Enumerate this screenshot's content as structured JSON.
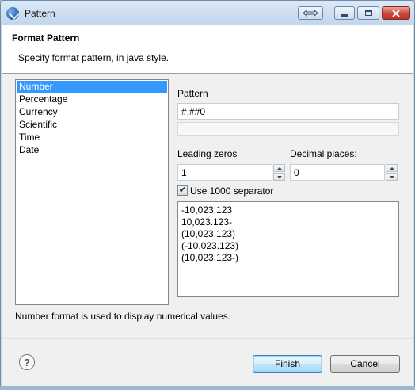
{
  "window": {
    "title": "Pattern",
    "icon": "app-icon",
    "controls": [
      "resize-icon",
      "minimize-icon",
      "maximize-icon",
      "close-icon"
    ]
  },
  "header": {
    "title": "Format Pattern",
    "description": "Specify format pattern, in java style."
  },
  "categories": {
    "items": [
      "Number",
      "Percentage",
      "Currency",
      "Scientific",
      "Time",
      "Date"
    ],
    "selected": "Number"
  },
  "pattern": {
    "label": "Pattern",
    "value": "#,##0",
    "secondary_value": ""
  },
  "leading_zeros": {
    "label": "Leading zeros",
    "value": "1"
  },
  "decimal_places": {
    "label": "Decimal places:",
    "value": "0"
  },
  "use_separator": {
    "label": "Use 1000 separator",
    "checked": true
  },
  "samples": [
    "-10,023.123",
    "10,023.123-",
    "(10,023.123)",
    "(-10,023.123)",
    "(10,023.123-)"
  ],
  "footer": {
    "description": "Number format is used to display numerical values."
  },
  "buttons": {
    "help_icon": "help-icon",
    "finish": "Finish",
    "cancel": "Cancel"
  },
  "colors": {
    "selection": "#3399ff",
    "titlebar": "#c9dcef",
    "close_button": "#c8483a"
  }
}
